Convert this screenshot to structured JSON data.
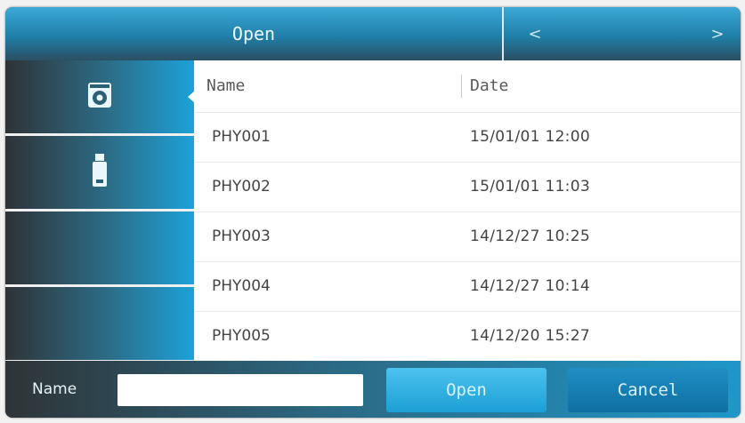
{
  "header": {
    "title": "Open",
    "prev_glyph": "<",
    "next_glyph": ">"
  },
  "sidebar": {
    "items": [
      {
        "icon": "hard-disk-icon",
        "selected": true
      },
      {
        "icon": "usb-drive-icon",
        "selected": false
      },
      {
        "icon": "",
        "selected": false
      },
      {
        "icon": "",
        "selected": false
      }
    ]
  },
  "list": {
    "columns": {
      "name": "Name",
      "date": "Date"
    },
    "rows": [
      {
        "name": "PHY001",
        "date": "15/01/01 12:00"
      },
      {
        "name": "PHY002",
        "date": "15/01/01 11:03"
      },
      {
        "name": "PHY003",
        "date": "14/12/27 10:25"
      },
      {
        "name": "PHY004",
        "date": "14/12/27 10:14"
      },
      {
        "name": "PHY005",
        "date": "14/12/20 15:27"
      }
    ]
  },
  "footer": {
    "name_label": "Name",
    "name_value": "",
    "open_label": "Open",
    "cancel_label": "Cancel"
  }
}
